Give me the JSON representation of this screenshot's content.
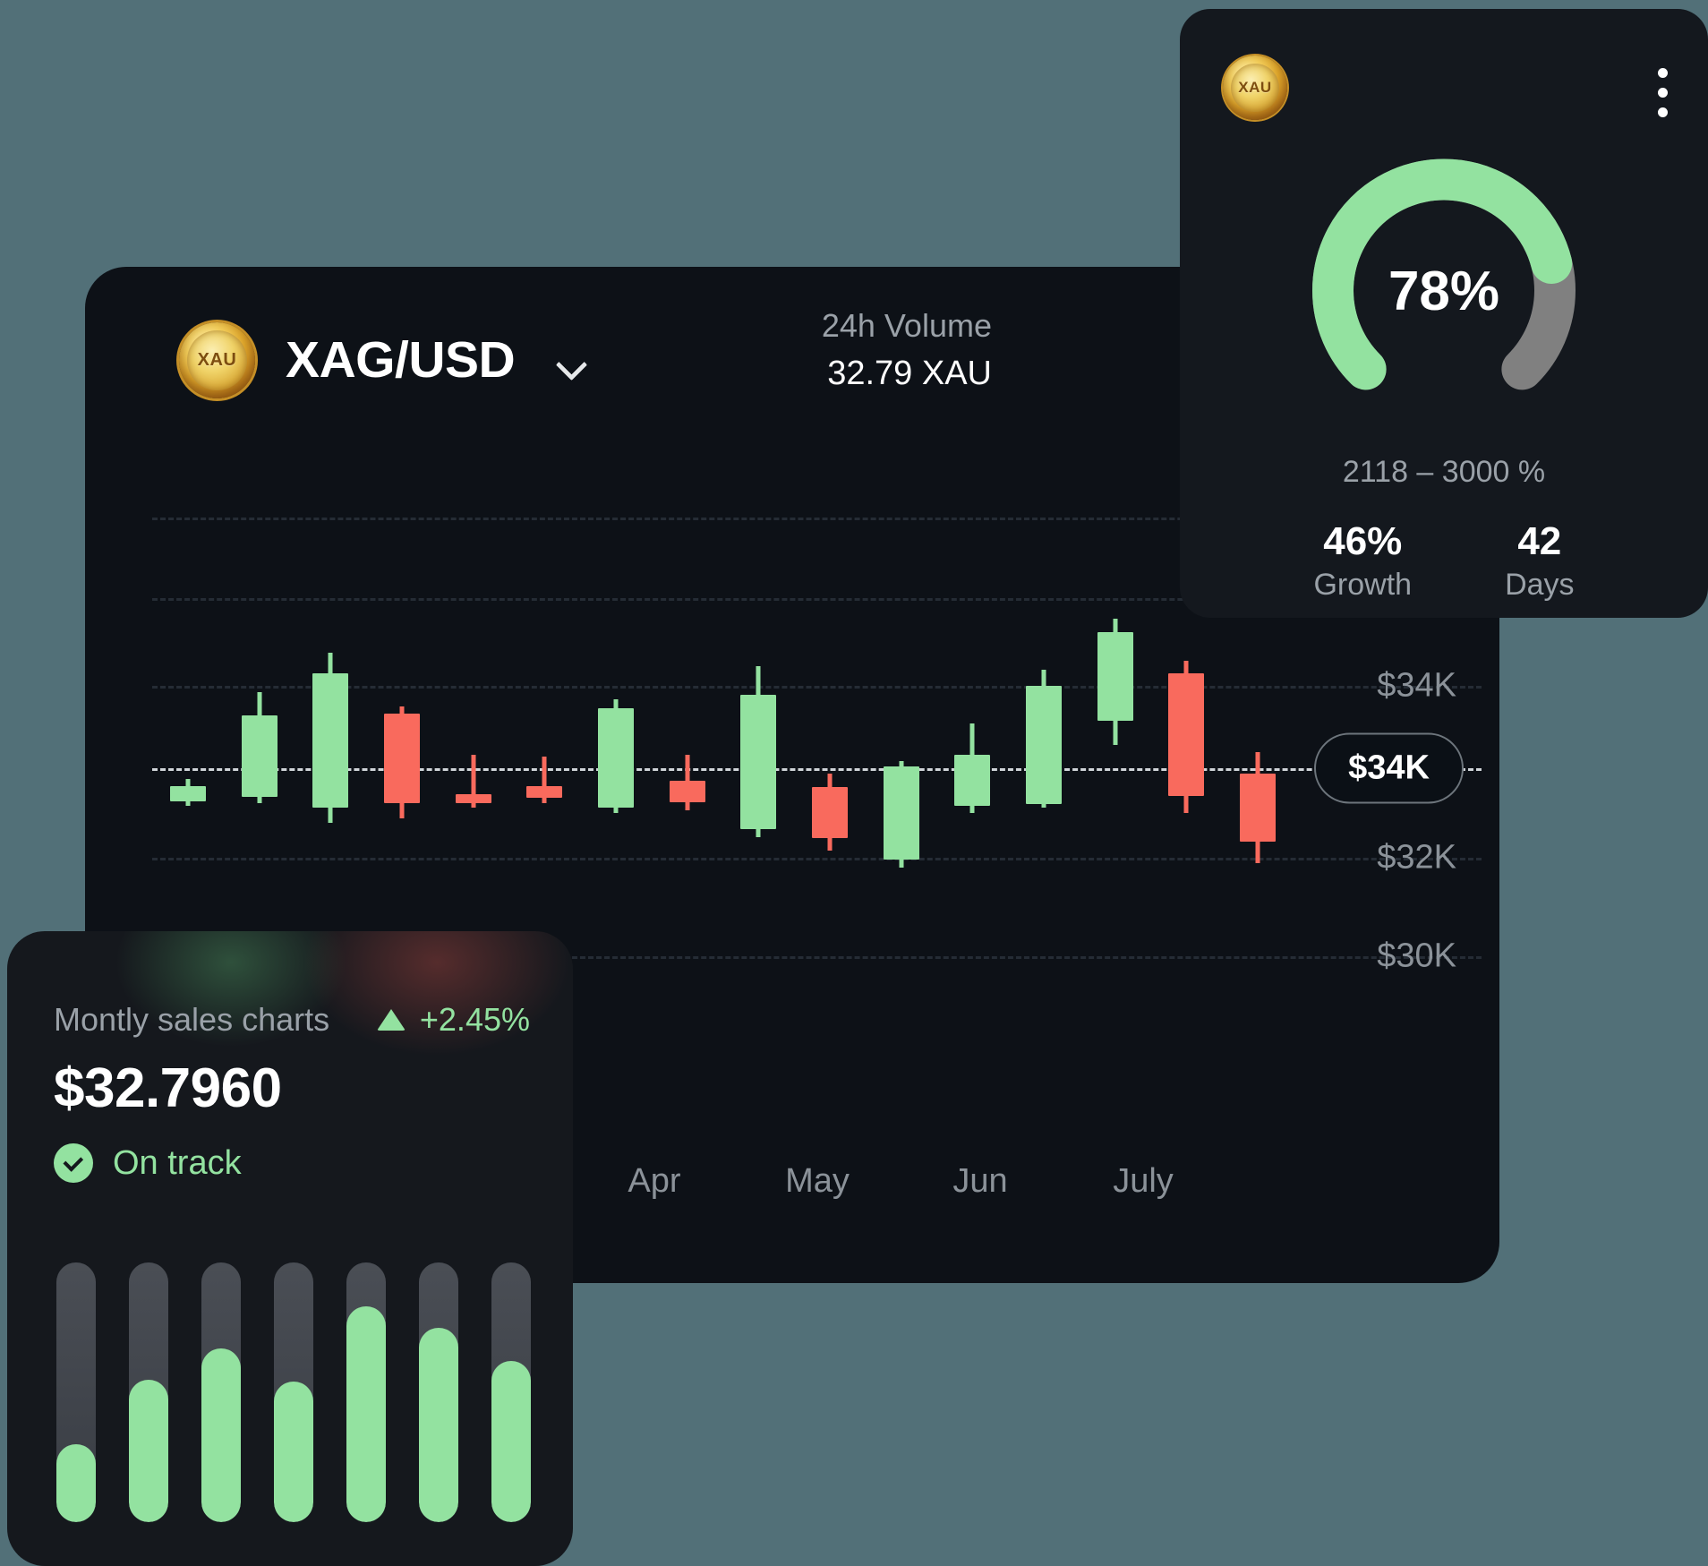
{
  "trading_card": {
    "coin_symbol": "XAU",
    "pair": "XAG/USD",
    "dropdown_icon": "chevron-down-icon",
    "volume_label": "24h Volume",
    "volume_value": "32.79 XAU",
    "price_pill": "$34K"
  },
  "gauge_card": {
    "coin_symbol": "XAU",
    "menu_icon": "kebab-menu-icon",
    "percent": "78%",
    "range": "2118 – 3000 %",
    "stats": [
      {
        "value": "46%",
        "label": "Growth"
      },
      {
        "value": "42",
        "label": "Days"
      }
    ]
  },
  "sales_card": {
    "title": "Montly sales charts",
    "delta": "+2.45%",
    "delta_icon": "triangle-up-icon",
    "amount": "$32.7960",
    "status": "On track",
    "status_icon": "check-circle-icon"
  },
  "colors": {
    "page_bg": "#527078",
    "card_bg": "#0d1117",
    "gauge_card_bg": "#14181e",
    "sales_card_bg": "#15181d",
    "green": "#93e2a0",
    "red": "#f96a5d",
    "grey_track": "#808080",
    "muted_text": "#8b9299"
  },
  "chart_data": {
    "type": "candlestick",
    "title": "XAG/USD",
    "xlabel": "",
    "ylabel": "",
    "grid": true,
    "legend": "none",
    "ylim": [
      29000,
      36500
    ],
    "ytick_labels": [
      "$34K",
      "$32K",
      "$30K"
    ],
    "ytick_values": [
      34000,
      32000,
      30000
    ],
    "xtick_labels": [
      "Apr",
      "May",
      "Jun",
      "July"
    ],
    "marker_line": {
      "label": "$34K",
      "value": 33000
    },
    "candles": [
      {
        "i": 1,
        "dir": "up",
        "open": 32830,
        "close": 32990,
        "high": 33060,
        "low": 32780
      },
      {
        "i": 2,
        "dir": "up",
        "open": 32870,
        "close": 33740,
        "high": 33980,
        "low": 32810
      },
      {
        "i": 3,
        "dir": "up",
        "open": 32760,
        "close": 34180,
        "high": 34400,
        "low": 32600
      },
      {
        "i": 4,
        "dir": "down",
        "open": 33760,
        "close": 32810,
        "high": 33830,
        "low": 32650
      },
      {
        "i": 5,
        "dir": "down",
        "open": 32900,
        "close": 32810,
        "high": 33320,
        "low": 32760
      },
      {
        "i": 6,
        "dir": "down",
        "open": 32990,
        "close": 32860,
        "high": 33300,
        "low": 32810
      },
      {
        "i": 7,
        "dir": "up",
        "open": 32760,
        "close": 33810,
        "high": 33910,
        "low": 32700
      },
      {
        "i": 8,
        "dir": "down",
        "open": 33040,
        "close": 32820,
        "high": 33320,
        "low": 32730
      },
      {
        "i": 9,
        "dir": "up",
        "open": 32530,
        "close": 33960,
        "high": 34260,
        "low": 32450
      },
      {
        "i": 10,
        "dir": "down",
        "open": 32980,
        "close": 32440,
        "high": 33120,
        "low": 32300
      },
      {
        "i": 11,
        "dir": "up",
        "open": 32210,
        "close": 33200,
        "high": 33250,
        "low": 32120
      },
      {
        "i": 12,
        "dir": "up",
        "open": 32780,
        "close": 33320,
        "high": 33650,
        "low": 32700
      },
      {
        "i": 13,
        "dir": "up",
        "open": 32800,
        "close": 34050,
        "high": 34220,
        "low": 32760
      },
      {
        "i": 14,
        "dir": "up",
        "open": 33680,
        "close": 34620,
        "high": 34760,
        "low": 33420
      },
      {
        "i": 15,
        "dir": "down",
        "open": 34180,
        "close": 32880,
        "high": 34320,
        "low": 32700
      },
      {
        "i": 16,
        "dir": "down",
        "open": 33120,
        "close": 32400,
        "high": 33350,
        "low": 32170
      }
    ]
  },
  "sales_bars": {
    "type": "bar",
    "track_max": 100,
    "values": [
      30,
      55,
      67,
      54,
      83,
      75,
      62
    ]
  }
}
